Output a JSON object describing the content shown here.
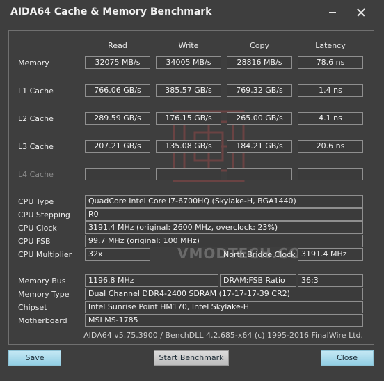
{
  "window": {
    "title": "AIDA64 Cache & Memory Benchmark"
  },
  "columns": [
    "Read",
    "Write",
    "Copy",
    "Latency"
  ],
  "bench": [
    {
      "label": "Memory",
      "read": "32075 MB/s",
      "write": "34005 MB/s",
      "copy": "28816 MB/s",
      "latency": "78.6 ns"
    },
    {
      "label": "L1 Cache",
      "read": "766.06 GB/s",
      "write": "385.57 GB/s",
      "copy": "769.32 GB/s",
      "latency": "1.4 ns"
    },
    {
      "label": "L2 Cache",
      "read": "289.59 GB/s",
      "write": "176.15 GB/s",
      "copy": "265.00 GB/s",
      "latency": "4.1 ns"
    },
    {
      "label": "L3 Cache",
      "read": "207.21 GB/s",
      "write": "135.08 GB/s",
      "copy": "184.21 GB/s",
      "latency": "20.6 ns"
    },
    {
      "label": "L4 Cache",
      "read": "",
      "write": "",
      "copy": "",
      "latency": ""
    }
  ],
  "cpu": {
    "type_label": "CPU Type",
    "type": "QuadCore Intel Core i7-6700HQ  (Skylake-H, BGA1440)",
    "stepping_label": "CPU Stepping",
    "stepping": "R0",
    "clock_label": "CPU Clock",
    "clock": "3191.4 MHz  (original: 2600 MHz, overclock: 23%)",
    "fsb_label": "CPU FSB",
    "fsb": "99.7 MHz  (original: 100 MHz)",
    "mult_label": "CPU Multiplier",
    "mult": "32x",
    "nb_label": "North Bridge Clock",
    "nb": "3191.4 MHz"
  },
  "memory": {
    "bus_label": "Memory Bus",
    "bus": "1196.8 MHz",
    "ratio_label": "DRAM:FSB Ratio",
    "ratio": "36:3",
    "type_label": "Memory Type",
    "type": "Dual Channel DDR4-2400 SDRAM  (17-17-17-39 CR2)",
    "chipset_label": "Chipset",
    "chipset": "Intel Sunrise Point HM170, Intel Skylake-H",
    "mb_label": "Motherboard",
    "mb": "MSI MS-1785"
  },
  "footer": "AIDA64 v5.75.3900 / BenchDLL 4.2.685-x64  (c) 1995-2016 FinalWire Ltd.",
  "watermark_text": "VMODTECH.COM",
  "buttons": {
    "save_u": "S",
    "save_rest": "ave",
    "start_a": "Start ",
    "start_u": "B",
    "start_b": "enchmark",
    "close_u": "C",
    "close_rest": "lose"
  },
  "colors": {
    "background": "#3e3e3e",
    "button": "#a8dcef",
    "watermark": "#c85050"
  }
}
